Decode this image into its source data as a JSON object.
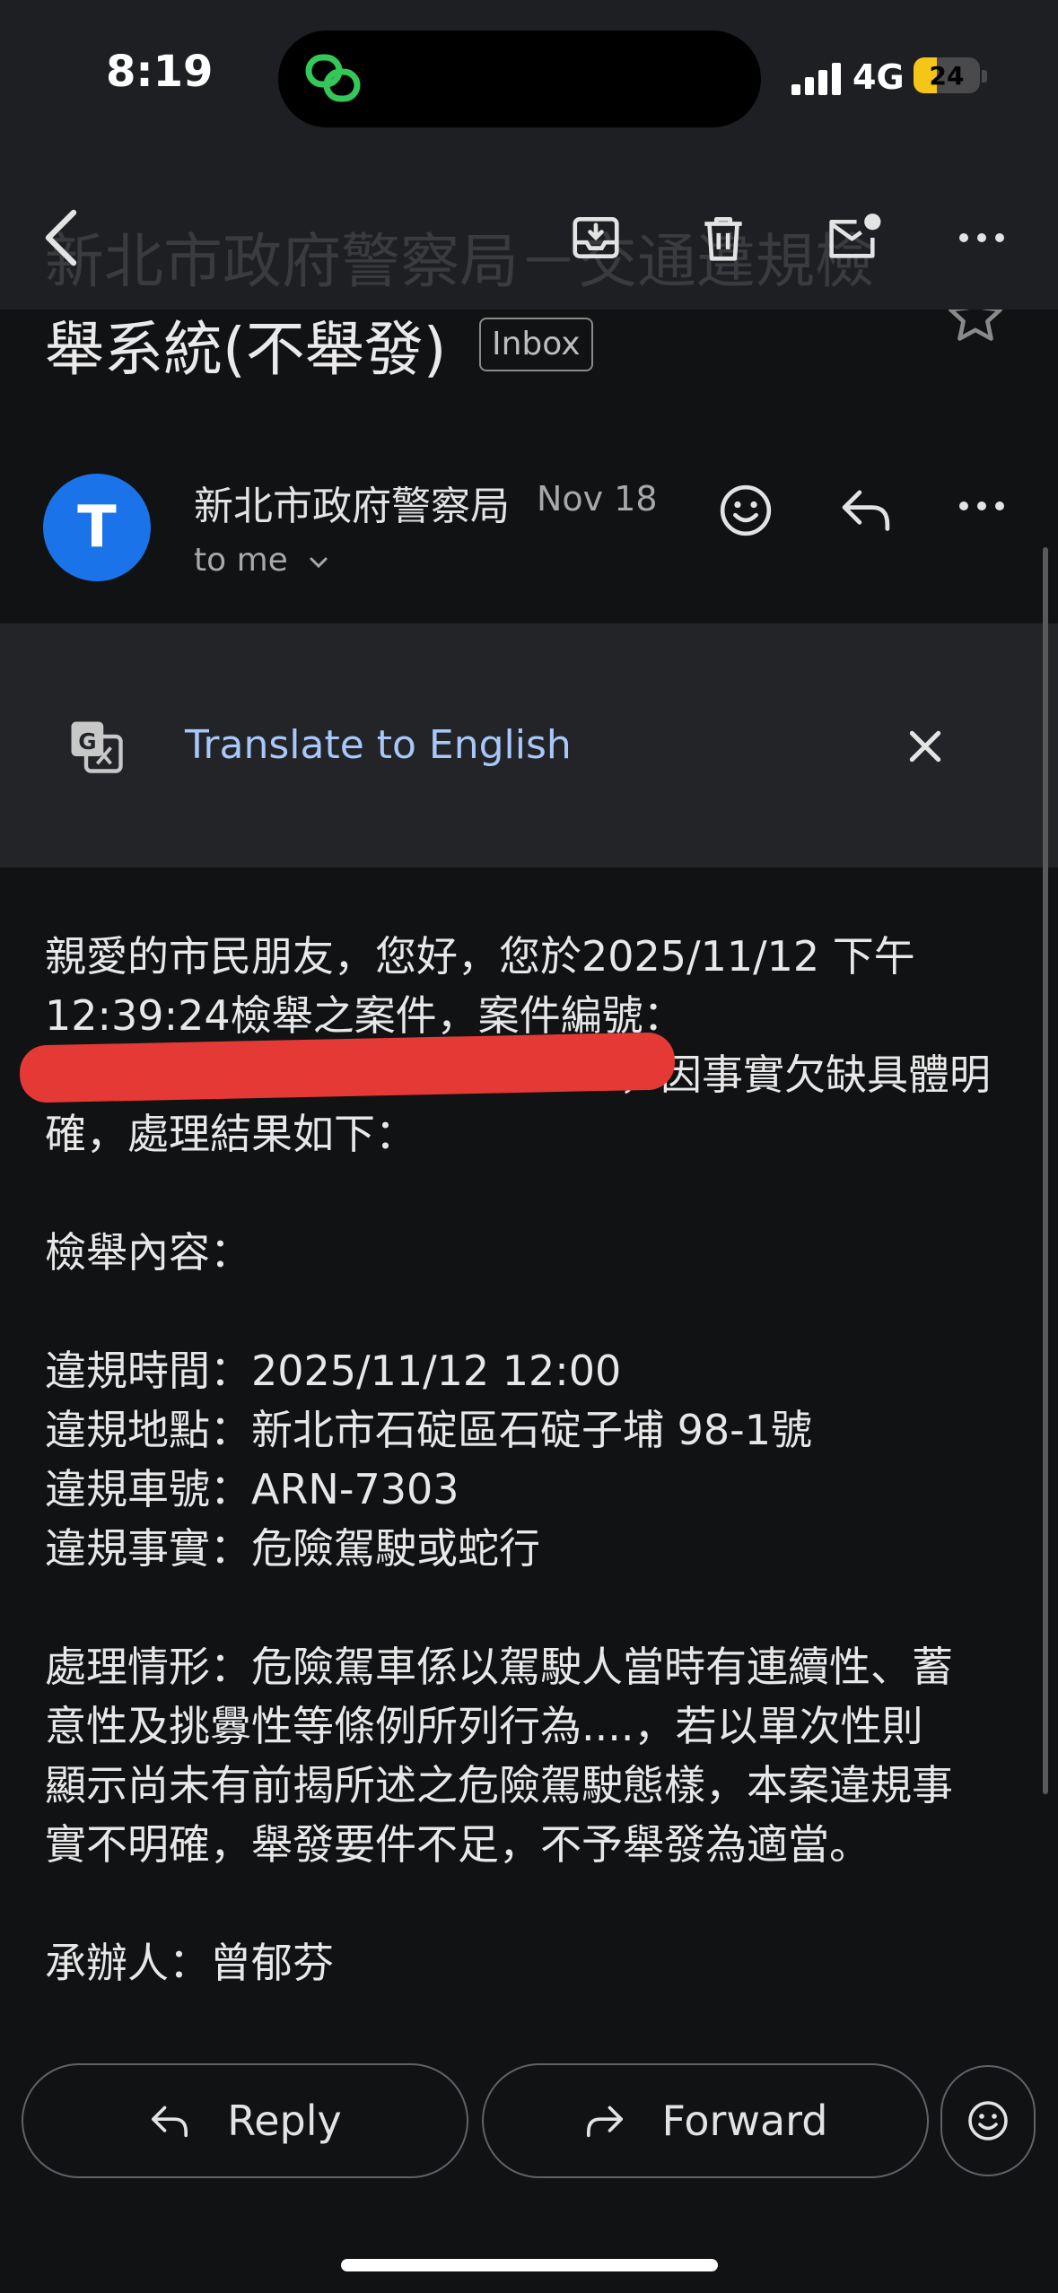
{
  "status_bar": {
    "time": "8:19",
    "network": "4G",
    "battery_level": "24"
  },
  "app_bar": {
    "ghost_title": "新北市政府警察局－交通違規檢"
  },
  "subject": {
    "line2": "舉系統(不舉發)",
    "label_chip": "Inbox"
  },
  "sender": {
    "avatar_letter": "T",
    "name": "新北市政府警察局",
    "date": "Nov 18",
    "recipient": "to me"
  },
  "translate": {
    "link_text": "Translate to English"
  },
  "body": {
    "lines": [
      "親愛的市民朋友，您好，您於2025/11/12 下午",
      "12:39:24檢舉之案件，案件編號：",
      "，因事實欠缺具體明",
      "確，處理結果如下：",
      "檢舉內容：",
      "違規時間：2025/11/12 12:00",
      "違規地點：新北市石碇區石碇子埔 98-1號",
      "違規車號：ARN-7303",
      "違規事實：危險駕駛或蛇行",
      "處理情形：危險駕車係以駕駛人當時有連續性、蓄",
      "意性及挑釁性等條例所列行為....，若以單次性則",
      "顯示尚未有前揭所述之危險駕駛態樣，本案違規事",
      "實不明確，舉發要件不足，不予舉發為適當。",
      "承辦人：曾郁芬"
    ]
  },
  "actions": {
    "reply_label": "Reply",
    "forward_label": "Forward"
  },
  "icons": {
    "back": "back-arrow-icon",
    "archive": "archive-icon",
    "delete": "trash-icon",
    "mark_unread": "mark-unread-icon",
    "more": "more-dots-icon",
    "star": "star-icon",
    "emoji": "emoji-icon",
    "reply": "reply-icon",
    "translate": "translate-icon",
    "close": "close-icon",
    "forward": "forward-icon"
  },
  "colors": {
    "background": "#111214",
    "bar": "#1e1f22",
    "avatar": "#1a73e8",
    "link": "#a8c7fa",
    "redaction": "#e53935",
    "battery": "#f5c518"
  }
}
